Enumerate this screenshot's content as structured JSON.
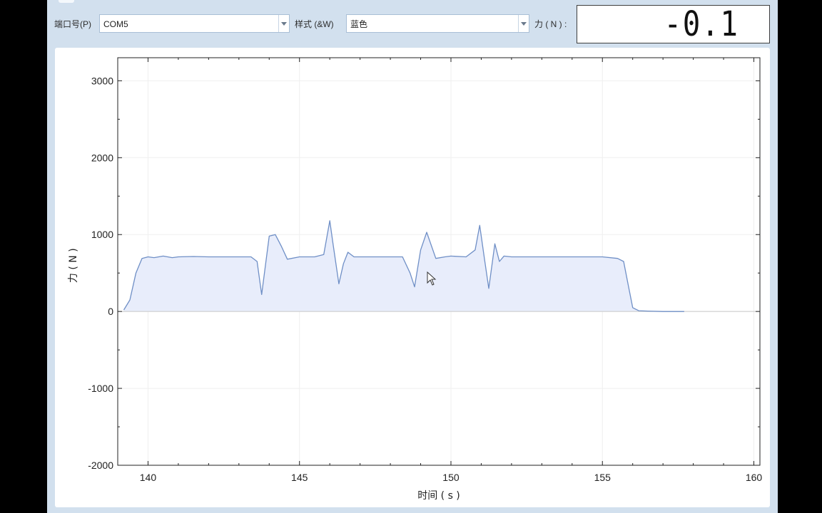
{
  "toolbar": {
    "port_label": "端口号(P)",
    "port_value": "COM5",
    "style_label": "样式 (&W)",
    "style_value": "蓝色",
    "force_label": "力 ( N ) :",
    "force_value": "-0.1"
  },
  "colors": {
    "series_line": "#6f8fc6",
    "series_fill": "#e8edfb",
    "window_bg": "#d2e0ee"
  },
  "chart_data": {
    "type": "area",
    "title": "",
    "xlabel": "时间 ( s )",
    "ylabel": "力 ( N )",
    "xlim": [
      139,
      160.2
    ],
    "ylim": [
      -2000,
      3300
    ],
    "xticks": [
      140,
      145,
      150,
      155,
      160
    ],
    "xtick_labels": [
      "140",
      "145",
      "150",
      "155",
      "160"
    ],
    "yticks": [
      -2000,
      -1000,
      0,
      1000,
      2000,
      3000
    ],
    "ytick_labels": [
      "-2000",
      "-1000",
      "0",
      "1000",
      "2000",
      "3000"
    ],
    "grid": true,
    "legend": "none",
    "series": [
      {
        "x": [
          139.2,
          139.4,
          139.6,
          139.8,
          140.0,
          140.2,
          140.5,
          140.8,
          141.0,
          141.5,
          142.0,
          142.5,
          143.0,
          143.4,
          143.6,
          143.75,
          144.0,
          144.2,
          144.4,
          144.6,
          145.0,
          145.5,
          145.8,
          146.0,
          146.1,
          146.3,
          146.45,
          146.6,
          146.8,
          147.5,
          148.0,
          148.4,
          148.65,
          148.8,
          149.0,
          149.2,
          149.5,
          149.8,
          150.0,
          150.5,
          150.8,
          150.95,
          151.1,
          151.25,
          151.45,
          151.6,
          151.75,
          152.0,
          153.0,
          154.0,
          155.0,
          155.5,
          155.7,
          155.85,
          156.0,
          156.2,
          156.5,
          157.0,
          157.7
        ],
        "y": [
          20,
          150,
          500,
          690,
          710,
          700,
          720,
          700,
          710,
          715,
          710,
          710,
          710,
          710,
          650,
          220,
          980,
          1000,
          850,
          680,
          710,
          710,
          740,
          1180,
          900,
          360,
          620,
          770,
          710,
          710,
          710,
          710,
          500,
          320,
          800,
          1030,
          690,
          710,
          720,
          710,
          800,
          1120,
          700,
          300,
          880,
          650,
          720,
          710,
          710,
          710,
          710,
          690,
          650,
          350,
          50,
          10,
          5,
          0,
          0
        ]
      }
    ]
  }
}
